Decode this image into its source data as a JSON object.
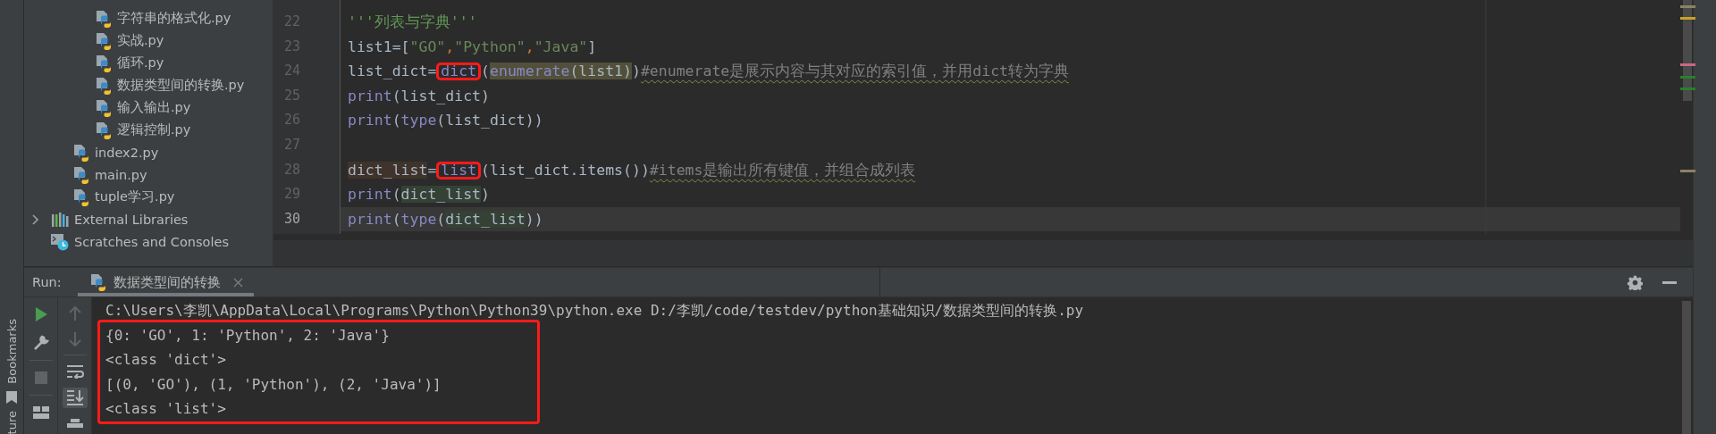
{
  "left_strip": {
    "labels": [
      "Bookmarks",
      "ture"
    ]
  },
  "project_tree": [
    {
      "children": [
        {
          "children": [
            {
              "label": "字符串的格式化.py",
              "kind": "python"
            },
            {
              "label": "实战.py",
              "kind": "python"
            },
            {
              "label": "循环.py",
              "kind": "python"
            },
            {
              "label": "数据类型间的转换.py",
              "kind": "python"
            },
            {
              "label": "输入输出.py",
              "kind": "python"
            },
            {
              "label": "逻辑控制.py",
              "kind": "python"
            }
          ]
        },
        {
          "label": "index2.py",
          "kind": "python"
        },
        {
          "label": "main.py",
          "kind": "python"
        },
        {
          "label": "tuple学习.py",
          "kind": "python"
        }
      ]
    },
    {
      "label": "External Libraries",
      "kind": "libraries",
      "expanded": false
    },
    {
      "label": "Scratches and Consoles",
      "kind": "scratches"
    }
  ],
  "editor": {
    "lines": [
      {
        "number": "22",
        "current": false,
        "segments": [
          {
            "text": "'''列表与字典'''",
            "kind": "docstring"
          }
        ]
      },
      {
        "number": "23",
        "current": false,
        "segments": [
          {
            "text": "list1=[",
            "kind": "plain"
          },
          {
            "text": "\"GO\"",
            "kind": "string"
          },
          {
            "text": ",",
            "kind": "punct"
          },
          {
            "text": "\"Python\"",
            "kind": "string"
          },
          {
            "text": ",",
            "kind": "punct"
          },
          {
            "text": "\"Java\"",
            "kind": "string"
          },
          {
            "text": "]",
            "kind": "plain"
          }
        ]
      },
      {
        "number": "24",
        "current": false,
        "segments": [
          {
            "text": "list_dict=",
            "kind": "plain"
          },
          {
            "text": "dict",
            "kind": "builtin",
            "boxed": true
          },
          {
            "text": "(",
            "kind": "plain"
          },
          {
            "text": "enumerate",
            "kind": "builtin",
            "search_match": true
          },
          {
            "text": "(list1)",
            "kind": "plain",
            "search_match": true
          },
          {
            "text": ")",
            "kind": "plain"
          },
          {
            "text": "#enumerate是展示内容与其对应的索引值，并用dict转为字典",
            "kind": "comment"
          }
        ]
      },
      {
        "number": "25",
        "current": false,
        "segments": [
          {
            "text": "print",
            "kind": "builtin"
          },
          {
            "text": "(list_dict)",
            "kind": "plain"
          }
        ]
      },
      {
        "number": "26",
        "current": false,
        "segments": [
          {
            "text": "print",
            "kind": "builtin"
          },
          {
            "text": "(",
            "kind": "plain"
          },
          {
            "text": "type",
            "kind": "builtin"
          },
          {
            "text": "(list_dict))",
            "kind": "plain"
          }
        ]
      },
      {
        "number": "27",
        "current": false
      },
      {
        "number": "28",
        "current": false,
        "segments": [
          {
            "text": "dict_list",
            "kind": "plain",
            "write_usage": true
          },
          {
            "text": "=",
            "kind": "plain"
          },
          {
            "text": "list",
            "kind": "builtin",
            "boxed": true
          },
          {
            "text": "(list_dict.items())",
            "kind": "plain"
          },
          {
            "text": "#items是输出所有键值，并组合成列表",
            "kind": "comment"
          }
        ]
      },
      {
        "number": "29",
        "current": false,
        "segments": [
          {
            "text": "print",
            "kind": "builtin"
          },
          {
            "text": "(",
            "kind": "plain"
          },
          {
            "text": "dict_list",
            "kind": "plain",
            "read_usage": true
          },
          {
            "text": ")",
            "kind": "plain"
          }
        ]
      },
      {
        "number": "30",
        "current": true,
        "segments": [
          {
            "text": "print",
            "kind": "builtin"
          },
          {
            "text": "(",
            "kind": "plain"
          },
          {
            "text": "type",
            "kind": "builtin"
          },
          {
            "text": "(",
            "kind": "plain"
          },
          {
            "text": "dict_list",
            "kind": "plain",
            "read_usage": true
          },
          {
            "text": "))",
            "kind": "plain"
          }
        ]
      }
    ]
  },
  "run_panel": {
    "label": "Run:",
    "tabs": [
      {
        "label": "数据类型间的转换",
        "selected": true
      }
    ],
    "toolbar": [
      {
        "kind": "rerun",
        "disabled": false
      },
      {
        "kind": "settings",
        "disabled": false
      },
      {
        "kind": "stop",
        "disabled": true
      },
      {
        "kind": "layout",
        "disabled": false
      }
    ],
    "toolbar_2": [
      {
        "kind": "up",
        "disabled": true
      },
      {
        "kind": "down",
        "disabled": true
      },
      {
        "kind": "wrap",
        "selected": false
      },
      {
        "kind": "scroll-end",
        "selected": true
      },
      {
        "kind": "print",
        "selected": false
      }
    ],
    "console": {
      "command": "C:\\Users\\李凯\\AppData\\Local\\Programs\\Python\\Python39\\python.exe D:/李凯/code/testdev/python基础知识/数据类型间的转换.py",
      "output_annotated": true,
      "output": [
        "{0: 'GO', 1: 'Python', 2: 'Java'}",
        "<class 'dict'>",
        "[(0, 'GO'), (1, 'Python'), (2, 'Java')]",
        "<class 'list'>"
      ]
    }
  }
}
